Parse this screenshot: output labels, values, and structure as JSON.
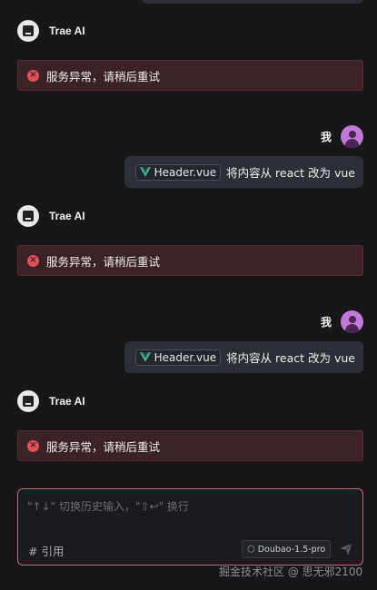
{
  "conversation": {
    "ai_name": "Trae AI",
    "user_name": "我",
    "error_icon": "error-x-icon",
    "error_message": "服务异常，请稍后重试",
    "user_message": {
      "file_icon": "vue-file-icon",
      "file_name": "Header.vue",
      "text": "将内容从 react 改为 vue"
    }
  },
  "input": {
    "placeholder": "\"↑↓\" 切换历史输入，\"⇧↩\" 换行",
    "reference_label": "# 引用",
    "model_name": "Doubao-1.5-pro",
    "send_icon": "send-icon"
  },
  "watermark": "掘金技术社区 @ 思无邪2100",
  "colors": {
    "background": "#17171a",
    "error_bg": "#3a2226",
    "error_border": "#5c2b31",
    "error_icon": "#e0505a",
    "input_border": "#c46a76",
    "user_avatar": "#c07ad6",
    "vue_green": "#41b883"
  }
}
